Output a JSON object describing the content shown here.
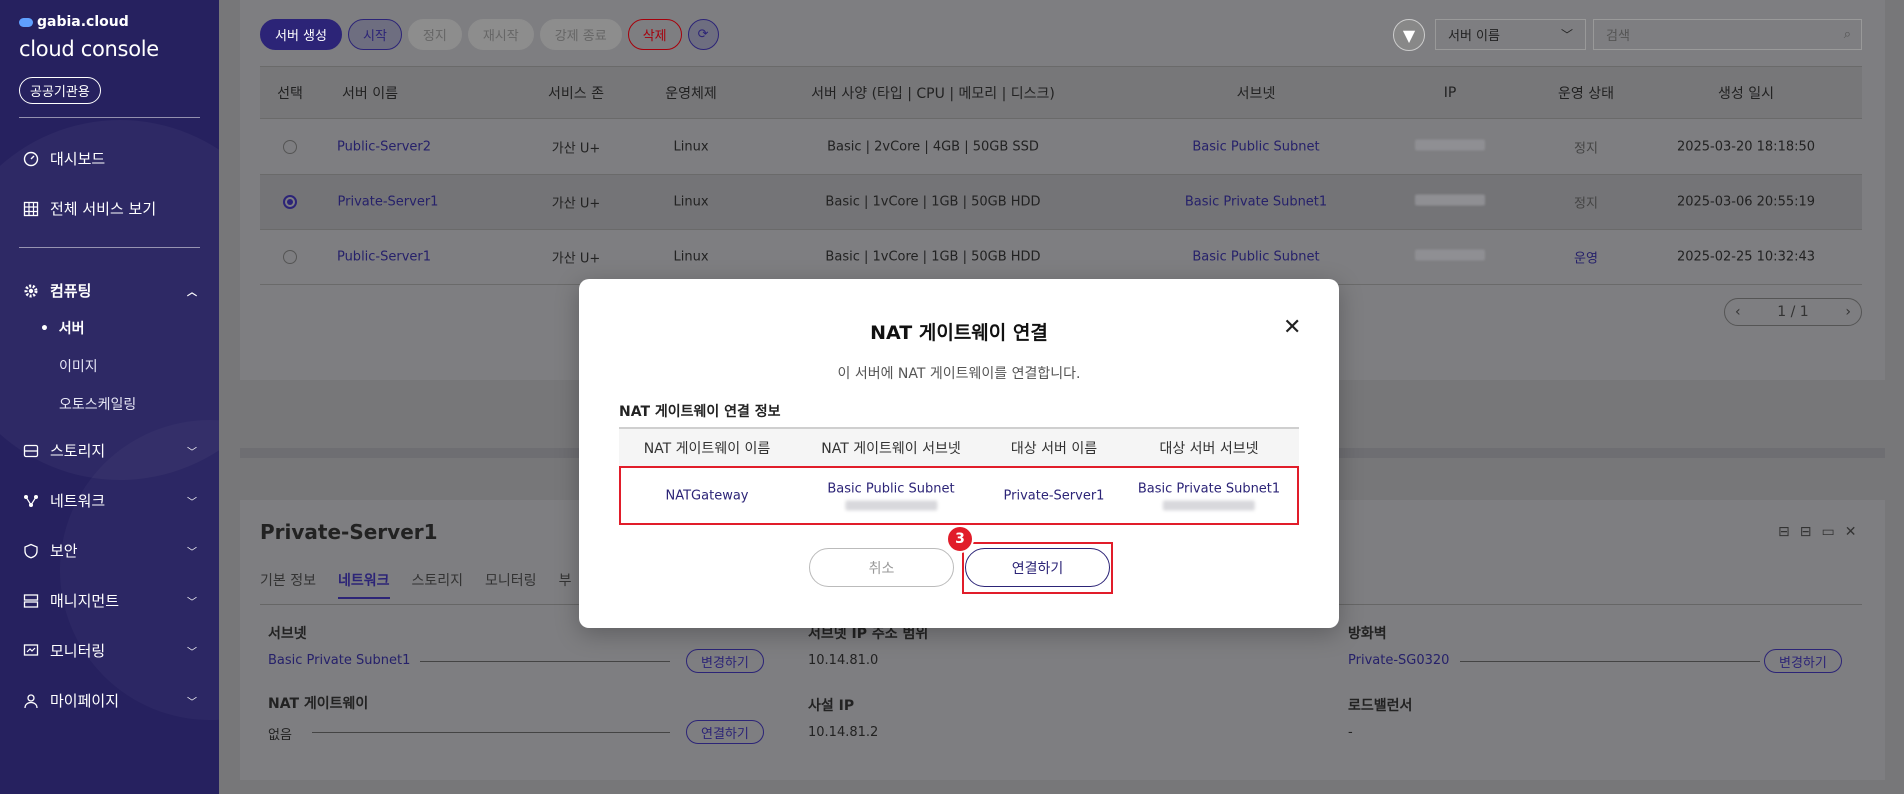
{
  "sidebar": {
    "brand_small": "gabia.cloud",
    "brand_main": "cloud console",
    "public_button": "공공기관용",
    "nav": [
      {
        "label": "대시보드",
        "icon": "dashboard-icon"
      },
      {
        "label": "전체 서비스 보기",
        "icon": "grid-icon"
      },
      {
        "label": "컴퓨팅",
        "icon": "gear-icon",
        "expanded": true
      },
      {
        "label": "스토리지",
        "icon": "storage-icon"
      },
      {
        "label": "네트워크",
        "icon": "network-icon"
      },
      {
        "label": "보안",
        "icon": "shield-icon"
      },
      {
        "label": "매니지먼트",
        "icon": "management-icon"
      },
      {
        "label": "모니터링",
        "icon": "monitor-icon"
      },
      {
        "label": "마이페이지",
        "icon": "user-icon"
      }
    ],
    "computing_sub": [
      "서버",
      "이미지",
      "오토스케일링"
    ]
  },
  "toolbar": {
    "create": "서버 생성",
    "start": "시작",
    "stop": "정지",
    "restart": "재시작",
    "force_stop": "강제 종료",
    "delete": "삭제",
    "filter_select": "서버 이름",
    "search_placeholder": "검색"
  },
  "table": {
    "headers": [
      "선택",
      "서버 이름",
      "서비스 존",
      "운영체제",
      "서버 사양 (타입 | CPU | 메모리 | 디스크)",
      "서브넷",
      "IP",
      "운영 상태",
      "생성 일시"
    ],
    "rows": [
      {
        "selected": false,
        "name": "Public-Server2",
        "zone": "가산 U+",
        "os": "Linux",
        "spec": "Basic | 2vCore | 4GB | 50GB SSD",
        "subnet": "Basic Public Subnet",
        "status": "정지",
        "created": "2025-03-20 18:18:50"
      },
      {
        "selected": true,
        "name": "Private-Server1",
        "zone": "가산 U+",
        "os": "Linux",
        "spec": "Basic | 1vCore | 1GB | 50GB HDD",
        "subnet": "Basic Private Subnet1",
        "status": "정지",
        "created": "2025-03-06 20:55:19"
      },
      {
        "selected": false,
        "name": "Public-Server1",
        "zone": "가산 U+",
        "os": "Linux",
        "spec": "Basic | 1vCore | 1GB | 50GB HDD",
        "subnet": "Basic Public Subnet",
        "status": "운영",
        "created": "2025-02-25 10:32:43"
      }
    ],
    "pager": "1 / 1"
  },
  "detail": {
    "title": "Private-Server1",
    "tabs": [
      "기본 정보",
      "네트워크",
      "스토리지",
      "모니터링",
      "부"
    ],
    "subnet_label": "서브넷",
    "subnet_value": "Basic Private Subnet1",
    "subnet_btn": "변경하기",
    "range_label": "서브넷 IP 주소 범위",
    "range_value": "10.14.81.0",
    "fw_label": "방화벽",
    "fw_value": "Private-SG0320",
    "fw_btn": "변경하기",
    "nat_label": "NAT 게이트웨이",
    "nat_value": "없음",
    "nat_btn": "연결하기",
    "pip_label": "사설 IP",
    "pip_value": "10.14.81.2",
    "lb_label": "로드밸런서",
    "lb_value": "-"
  },
  "modal": {
    "title": "NAT 게이트웨이 연결",
    "description": "이 서버에 NAT 게이트웨이를 연결합니다.",
    "section": "NAT 게이트웨이 연결 정보",
    "headers": [
      "NAT 게이트웨이 이름",
      "NAT 게이트웨이 서브넷",
      "대상 서버 이름",
      "대상 서버 서브넷"
    ],
    "row": {
      "nat_name": "NATGateway",
      "nat_subnet": "Basic Public Subnet",
      "server_name": "Private-Server1",
      "server_subnet": "Basic Private Subnet1"
    },
    "cancel": "취소",
    "confirm": "연결하기",
    "step": "3"
  }
}
